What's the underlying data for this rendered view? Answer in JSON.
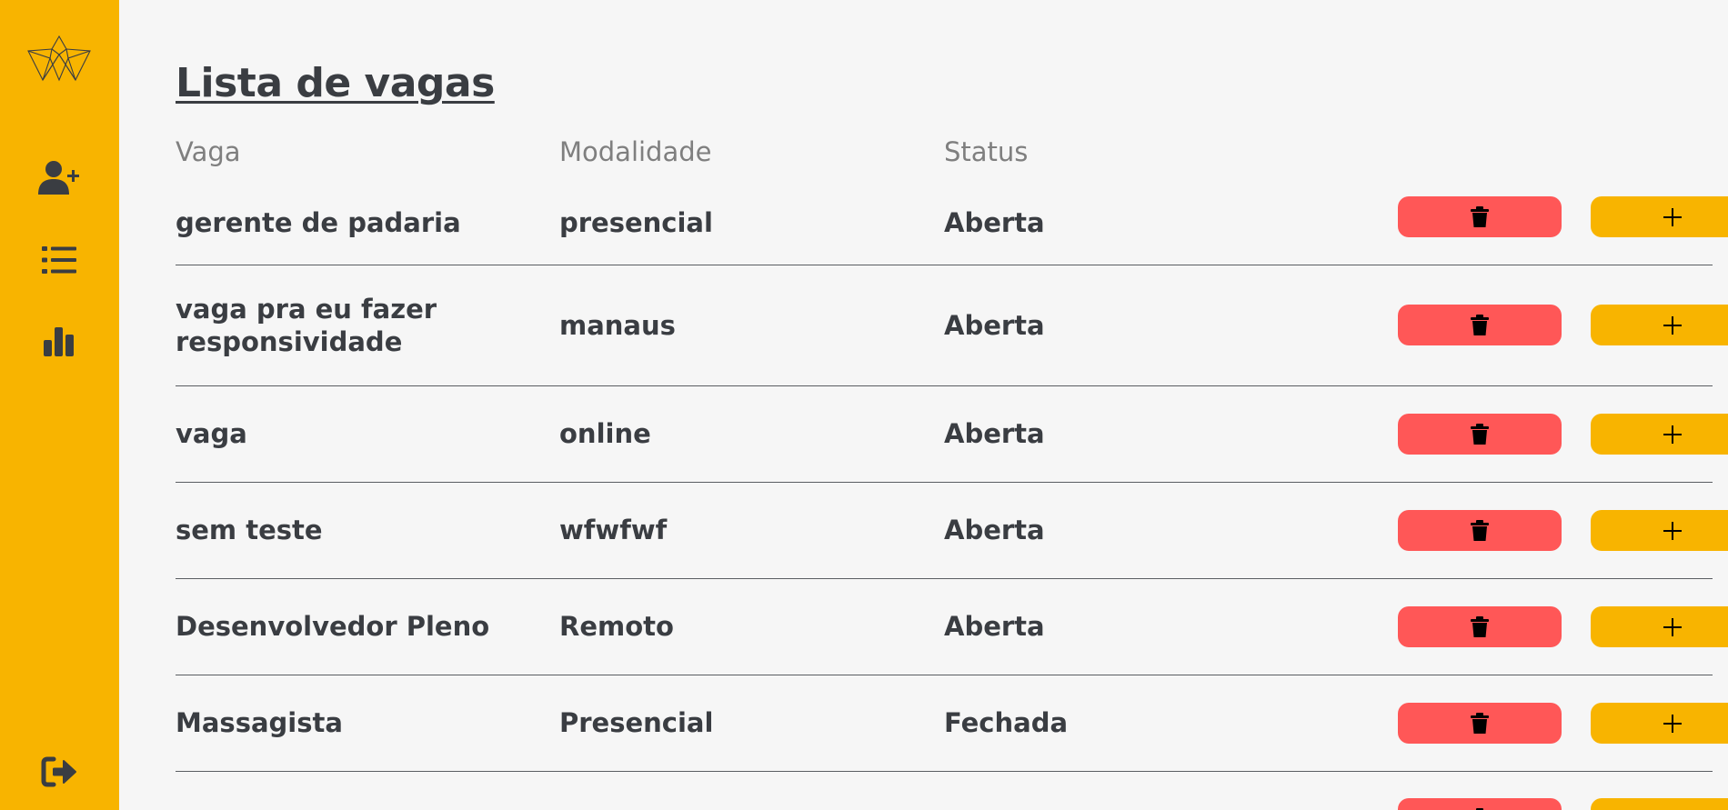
{
  "sidebar": {
    "logo_icon": "origami-logo",
    "items": [
      {
        "icon": "user-plus-icon"
      },
      {
        "icon": "list-icon"
      },
      {
        "icon": "bar-chart-icon"
      }
    ],
    "logout_icon": "logout-icon"
  },
  "page": {
    "title": "Lista de vagas"
  },
  "table": {
    "headers": [
      "Vaga",
      "Modalidade",
      "Status"
    ],
    "rows": [
      {
        "vaga": "gerente de padaria",
        "modalidade": "presencial",
        "status": "Aberta"
      },
      {
        "vaga": "vaga pra eu fazer responsividade",
        "modalidade": "manaus",
        "status": "Aberta"
      },
      {
        "vaga": "vaga",
        "modalidade": "online",
        "status": "Aberta"
      },
      {
        "vaga": "sem teste",
        "modalidade": "wfwfwf",
        "status": "Aberta"
      },
      {
        "vaga": "Desenvolvedor Pleno",
        "modalidade": "Remoto",
        "status": "Aberta"
      },
      {
        "vaga": "Massagista",
        "modalidade": "Presencial",
        "status": "Fechada"
      },
      {
        "vaga": "",
        "modalidade": "",
        "status": ""
      }
    ],
    "delete_icon": "trash-icon",
    "add_label": "+"
  },
  "colors": {
    "sidebar": "#f8b400",
    "delete_button": "#ff5757",
    "add_button": "#f8b400",
    "background": "#f6f6f6",
    "text": "#3a3d42"
  }
}
